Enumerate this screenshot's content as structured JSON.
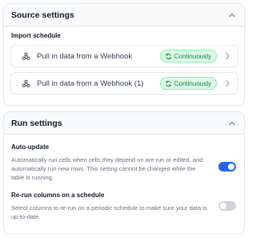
{
  "source_settings": {
    "title": "Source settings",
    "import_schedule_label": "Import schedule",
    "rows": [
      {
        "label": "Pull in data from a Webhook",
        "status": "Continuously"
      },
      {
        "label": "Pull in data from a Webhook (1)",
        "status": "Continuously"
      }
    ]
  },
  "run_settings": {
    "title": "Run settings",
    "auto_update": {
      "title": "Auto-update",
      "description": "Automatically run cells when cells they depend on are run or edited, and automatically run new rows. This setting cannot be changed while the table is running.",
      "enabled": true
    },
    "rerun": {
      "title": "Re-run columns on a schedule",
      "description": "Select columns to re-run on a periodic schedule to make sure your data is up-to-date.",
      "enabled": false
    }
  },
  "colors": {
    "accent": "#2563eb",
    "badge_bg": "#dcfce7",
    "badge_text": "#15803d"
  },
  "icons": {
    "webhook": "webhook-icon",
    "refresh": "refresh-icon",
    "chevron_right": "chevron-right-icon",
    "chevron_up": "chevron-up-icon"
  }
}
